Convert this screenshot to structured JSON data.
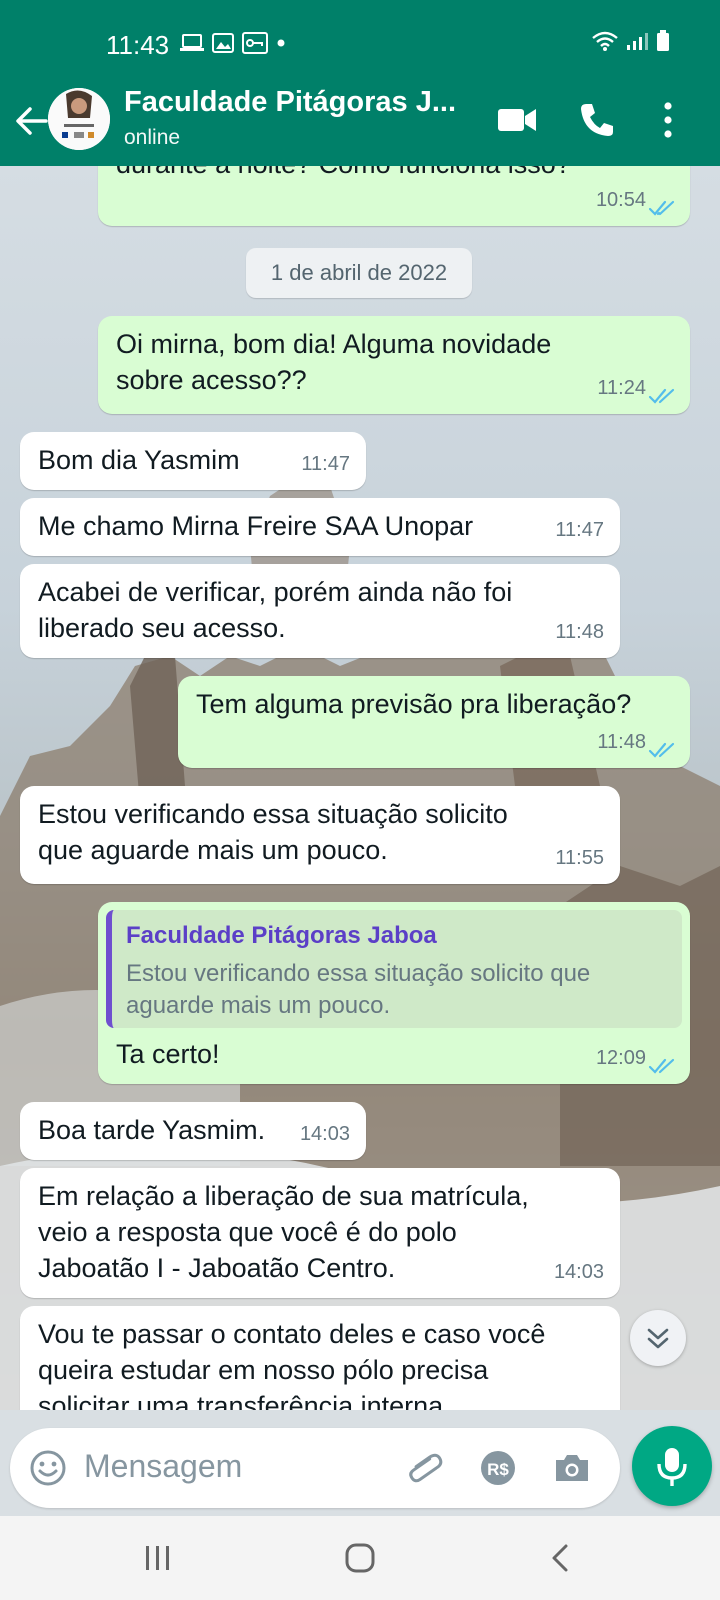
{
  "status_bar": {
    "time": "11:43"
  },
  "header": {
    "title": "Faculdade Pitágoras J...",
    "subtitle": "online",
    "accent_color": "#008069",
    "icons": [
      "back-arrow-icon",
      "video-call-icon",
      "voice-call-icon",
      "more-options-icon"
    ]
  },
  "chat": {
    "date_separator": "1 de abril de 2022",
    "messages": [
      {
        "direction": "out",
        "text": "durante a noite? Como funciona isso?",
        "time": "10:54",
        "status": "read"
      },
      {
        "direction": "out",
        "text": "Oi mirna, bom dia! Alguma novidade\nsobre acesso??",
        "time": "11:24",
        "status": "read"
      },
      {
        "direction": "in",
        "text": "Bom dia Yasmim",
        "time": "11:47"
      },
      {
        "direction": "in",
        "text": "Me chamo Mirna Freire SAA Unopar",
        "time": "11:47"
      },
      {
        "direction": "in",
        "text": "Acabei de verificar, porém ainda não foi\nliberado seu acesso.",
        "time": "11:48"
      },
      {
        "direction": "out",
        "text": "Tem alguma previsão pra liberação?",
        "time": "11:48",
        "status": "read"
      },
      {
        "direction": "in",
        "text": "Estou verificando essa situação solicito\nque aguarde mais um pouco.",
        "time": "11:55"
      },
      {
        "direction": "out",
        "text": "Ta certo!",
        "time": "12:09",
        "status": "read",
        "quote": {
          "author": "Faculdade Pitágoras Jaboa",
          "text": "Estou verificando essa situação solicito que\naguarde mais um pouco."
        }
      },
      {
        "direction": "in",
        "text": "Boa tarde Yasmim.",
        "time": "14:03"
      },
      {
        "direction": "in",
        "text": "Em relação a liberação de sua matrícula,\nveio a resposta que você é do polo\nJaboatão I  - Jaboatão Centro.",
        "time": "14:03"
      },
      {
        "direction": "in",
        "text": "Vou te passar o contato deles e caso você\nqueira estudar em nosso pólo precisa\nsolicitar uma transferência interna",
        "time": ""
      }
    ]
  },
  "composer": {
    "placeholder": "Mensagem",
    "icons": [
      "emoji-icon",
      "attach-icon",
      "payment-icon",
      "camera-icon",
      "mic-icon"
    ]
  },
  "colors": {
    "outgoing_bubble": "#d9fdd3",
    "incoming_bubble": "#ffffff",
    "read_ticks": "#53bdeb",
    "mic_button": "#00a884"
  }
}
